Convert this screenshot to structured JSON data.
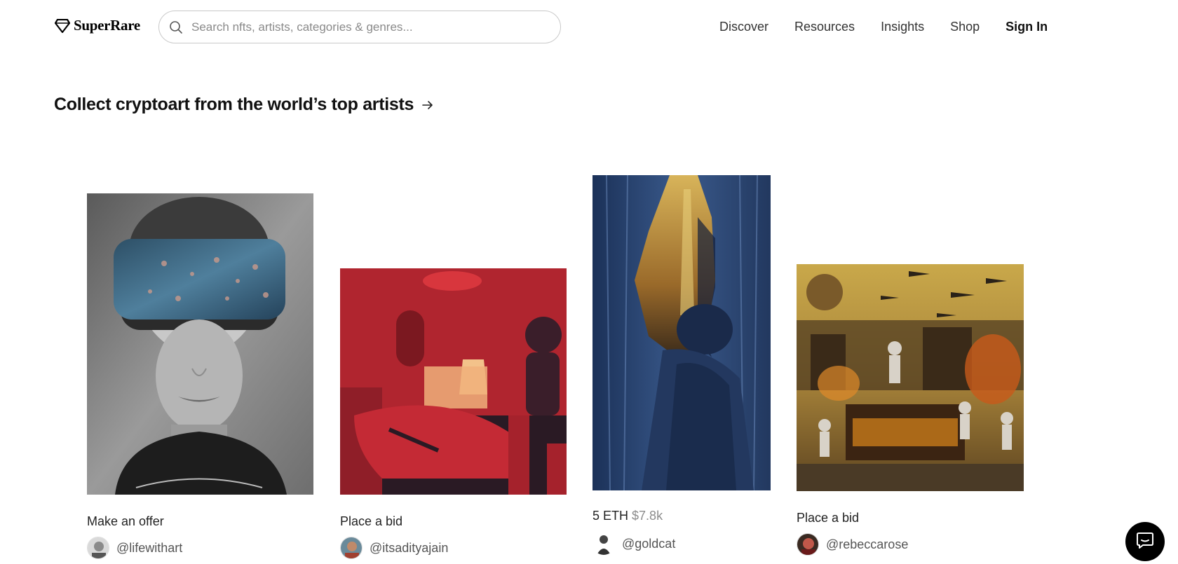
{
  "brand": {
    "name": "SuperRare",
    "logo_icon": "diamond-icon"
  },
  "search": {
    "placeholder": "Search nfts, artists, categories & genres..."
  },
  "nav": {
    "items": [
      "Discover",
      "Resources",
      "Insights",
      "Shop"
    ],
    "sign_in": "Sign In"
  },
  "headline": {
    "text": "Collect cryptoart from the world’s top artists",
    "icon": "arrow-right-icon"
  },
  "cards": [
    {
      "status": "Make an offer",
      "artist": "@lifewithart"
    },
    {
      "status": "Place a bid",
      "artist": "@itsadityajain"
    },
    {
      "price_eth": "5 ETH",
      "price_usd": "$7.8k",
      "artist": "@goldcat"
    },
    {
      "status": "Place a bid",
      "artist": "@rebeccarose"
    }
  ],
  "chat": {
    "icon": "chat-bubble-icon"
  }
}
